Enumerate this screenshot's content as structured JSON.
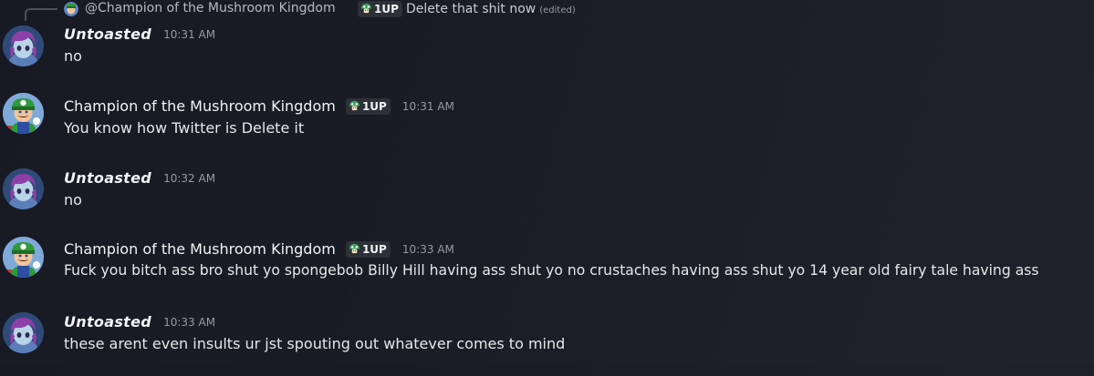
{
  "reply": {
    "mention": "@Champion of the Mushroom Kingdom",
    "badge": "1UP",
    "text": "Delete that shit now",
    "edited": "(edited)"
  },
  "messages": [
    {
      "author": "Untoasted",
      "time": "10:31 AM",
      "text": "no",
      "badge": ""
    },
    {
      "author": "Champion of the Mushroom Kingdom",
      "time": "10:31 AM",
      "text": "You know how Twitter is Delete it",
      "badge": "1UP"
    },
    {
      "author": "Untoasted",
      "time": "10:32 AM",
      "text": "no",
      "badge": ""
    },
    {
      "author": "Champion of the Mushroom Kingdom",
      "time": "10:33 AM",
      "text": "Fuck you bitch ass bro shut yo spongebob Billy Hill having ass shut yo no crustaches having ass shut yo 14 year old fairy tale having ass",
      "badge": "1UP"
    },
    {
      "author": "Untoasted",
      "time": "10:33 AM",
      "text": "these arent even insults ur jst spouting out whatever comes to mind",
      "badge": ""
    }
  ],
  "icons": {
    "badge_icon": "green-mushroom-icon",
    "untoasted_avatar": "purple-haired-character-avatar",
    "champion_avatar": "luigi-avatar"
  },
  "colors": {
    "background": "#1a1d26",
    "username": "#f2f3f5",
    "timestamp": "#949ba4",
    "badge_bg": "#2e3038",
    "mushroom_green": "#3ba55c"
  }
}
